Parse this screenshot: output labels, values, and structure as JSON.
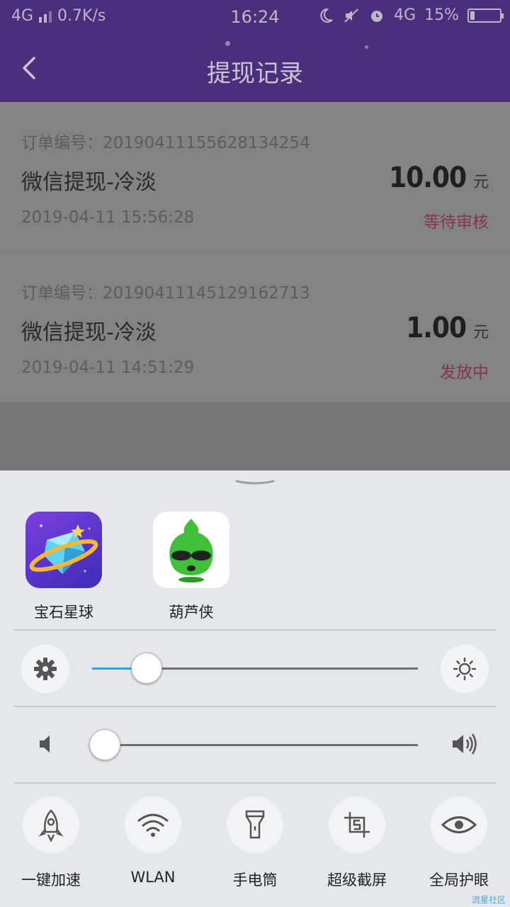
{
  "status_bar": {
    "network_left": "4G",
    "speed": "0.7K/s",
    "time": "16:24",
    "network_right": "4G",
    "battery": "15%"
  },
  "header": {
    "title": "提现记录"
  },
  "records": [
    {
      "order": "订单编号：20190411155628134254",
      "name": "微信提现-冷淡",
      "amount": "10.00",
      "unit": "元",
      "date": "2019-04-11 15:56:28",
      "status": "等待审核"
    },
    {
      "order": "订单编号：20190411145129162713",
      "name": "微信提现-冷淡",
      "amount": "1.00",
      "unit": "元",
      "date": "2019-04-11 14:51:29",
      "status": "发放中"
    }
  ],
  "panel": {
    "apps": [
      {
        "label": "宝石星球"
      },
      {
        "label": "葫芦侠"
      }
    ],
    "brightness_level": 0.12,
    "volume_level": 0.03,
    "toggles": [
      {
        "label": "一键加速",
        "icon": "rocket-icon"
      },
      {
        "label": "WLAN",
        "icon": "wifi-icon"
      },
      {
        "label": "手电筒",
        "icon": "flashlight-icon"
      },
      {
        "label": "超级截屏",
        "icon": "screenshot-icon"
      },
      {
        "label": "全局护眼",
        "icon": "eye-icon"
      }
    ]
  },
  "watermark": "流星社区",
  "colors": {
    "header_bg": "#4a2f7d",
    "status_text": "#85344f",
    "slider_fill": "#29a3e0",
    "panel_bg": "#e4e8eb"
  }
}
